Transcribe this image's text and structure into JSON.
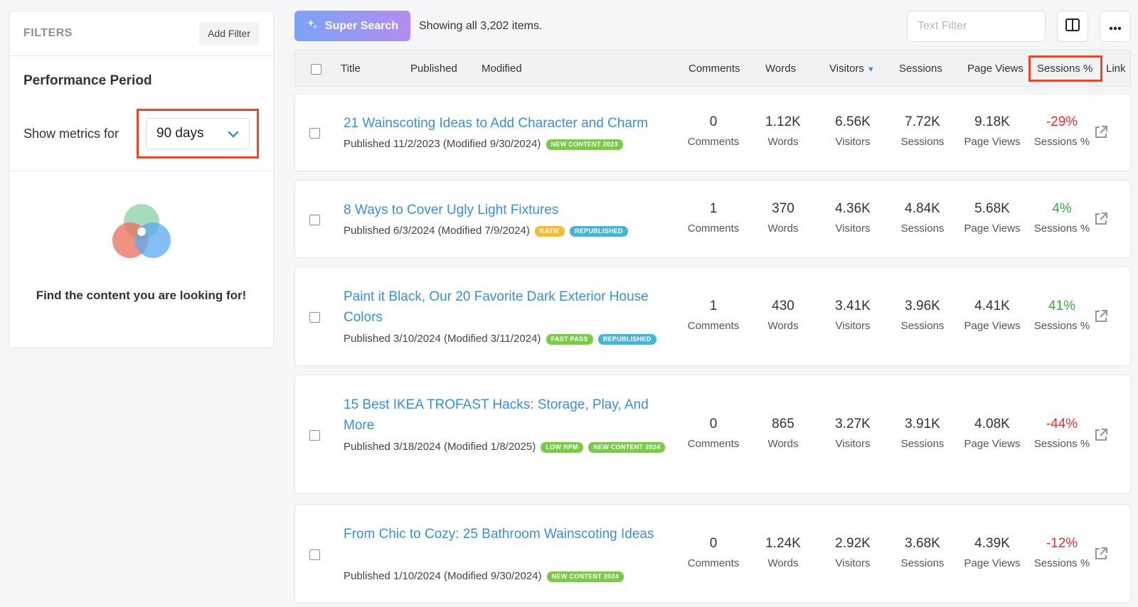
{
  "sidebar": {
    "title": "FILTERS",
    "add_filter": "Add Filter",
    "period_heading": "Performance Period",
    "show_metrics_label": "Show metrics for",
    "period_value": "90 days",
    "empty_message": "Find the content you are looking for!"
  },
  "toolbar": {
    "super_search": "Super Search",
    "count_text": "Showing all 3,202 items.",
    "text_filter_placeholder": "Text Filter"
  },
  "columns": {
    "title": "Title",
    "published": "Published",
    "modified": "Modified",
    "comments": "Comments",
    "words": "Words",
    "visitors": "Visitors",
    "sessions": "Sessions",
    "page_views": "Page Views",
    "sessions_pct": "Sessions %",
    "link": "Link"
  },
  "rows": [
    {
      "title": "21 Wainscoting Ideas to Add Character and Charm",
      "meta": "Published 11/2/2023 (Modified 9/30/2024)",
      "badges": [
        "NEW CONTENT 2023"
      ],
      "comments": "0",
      "words": "1.12K",
      "visitors": "6.56K",
      "sessions": "7.72K",
      "page_views": "9.18K",
      "sessions_pct": "-29%"
    },
    {
      "title": "8 Ways to Cover Ugly Light Fixtures",
      "meta": "Published 6/3/2024 (Modified 7/9/2024)",
      "badges": [
        "KATIE",
        "REPUBLISHED"
      ],
      "comments": "1",
      "words": "370",
      "visitors": "4.36K",
      "sessions": "4.84K",
      "page_views": "5.68K",
      "sessions_pct": "4%"
    },
    {
      "title": "Paint it Black, Our 20 Favorite Dark Exterior House Colors",
      "meta": "Published 3/10/2024 (Modified 3/11/2024)",
      "badges": [
        "FAST PASS",
        "REPUBLISHED"
      ],
      "comments": "1",
      "words": "430",
      "visitors": "3.41K",
      "sessions": "3.96K",
      "page_views": "4.41K",
      "sessions_pct": "41%"
    },
    {
      "title": "15 Best IKEA TROFAST Hacks: Storage, Play, And More",
      "meta": "Published 3/18/2024 (Modified 1/8/2025)",
      "badges": [
        "LOW RPM",
        "NEW CONTENT 2024"
      ],
      "comments": "0",
      "words": "865",
      "visitors": "3.27K",
      "sessions": "3.91K",
      "page_views": "4.08K",
      "sessions_pct": "-44%"
    },
    {
      "title": "From Chic to Cozy:  25 Bathroom Wainscoting Ideas",
      "meta": "Published 1/10/2024 (Modified 9/30/2024)",
      "badges": [
        "NEW CONTENT 2024"
      ],
      "comments": "0",
      "words": "1.24K",
      "visitors": "2.92K",
      "sessions": "3.68K",
      "page_views": "4.39K",
      "sessions_pct": "-12%"
    }
  ],
  "colors": {
    "accent": "#3a8fd9",
    "highlight": "#e24a2b",
    "negative": "#e03131",
    "positive": "#3aa845",
    "badge_green": "#7cc94b",
    "badge_blue": "#4bb4d3",
    "badge_yellow": "#f2bd3a"
  },
  "icons": [
    "sparkle-icon",
    "columns-icon",
    "more-icon",
    "chevron-down-icon",
    "sort-down-icon",
    "external-link-icon",
    "venn-diagram-icon"
  ]
}
